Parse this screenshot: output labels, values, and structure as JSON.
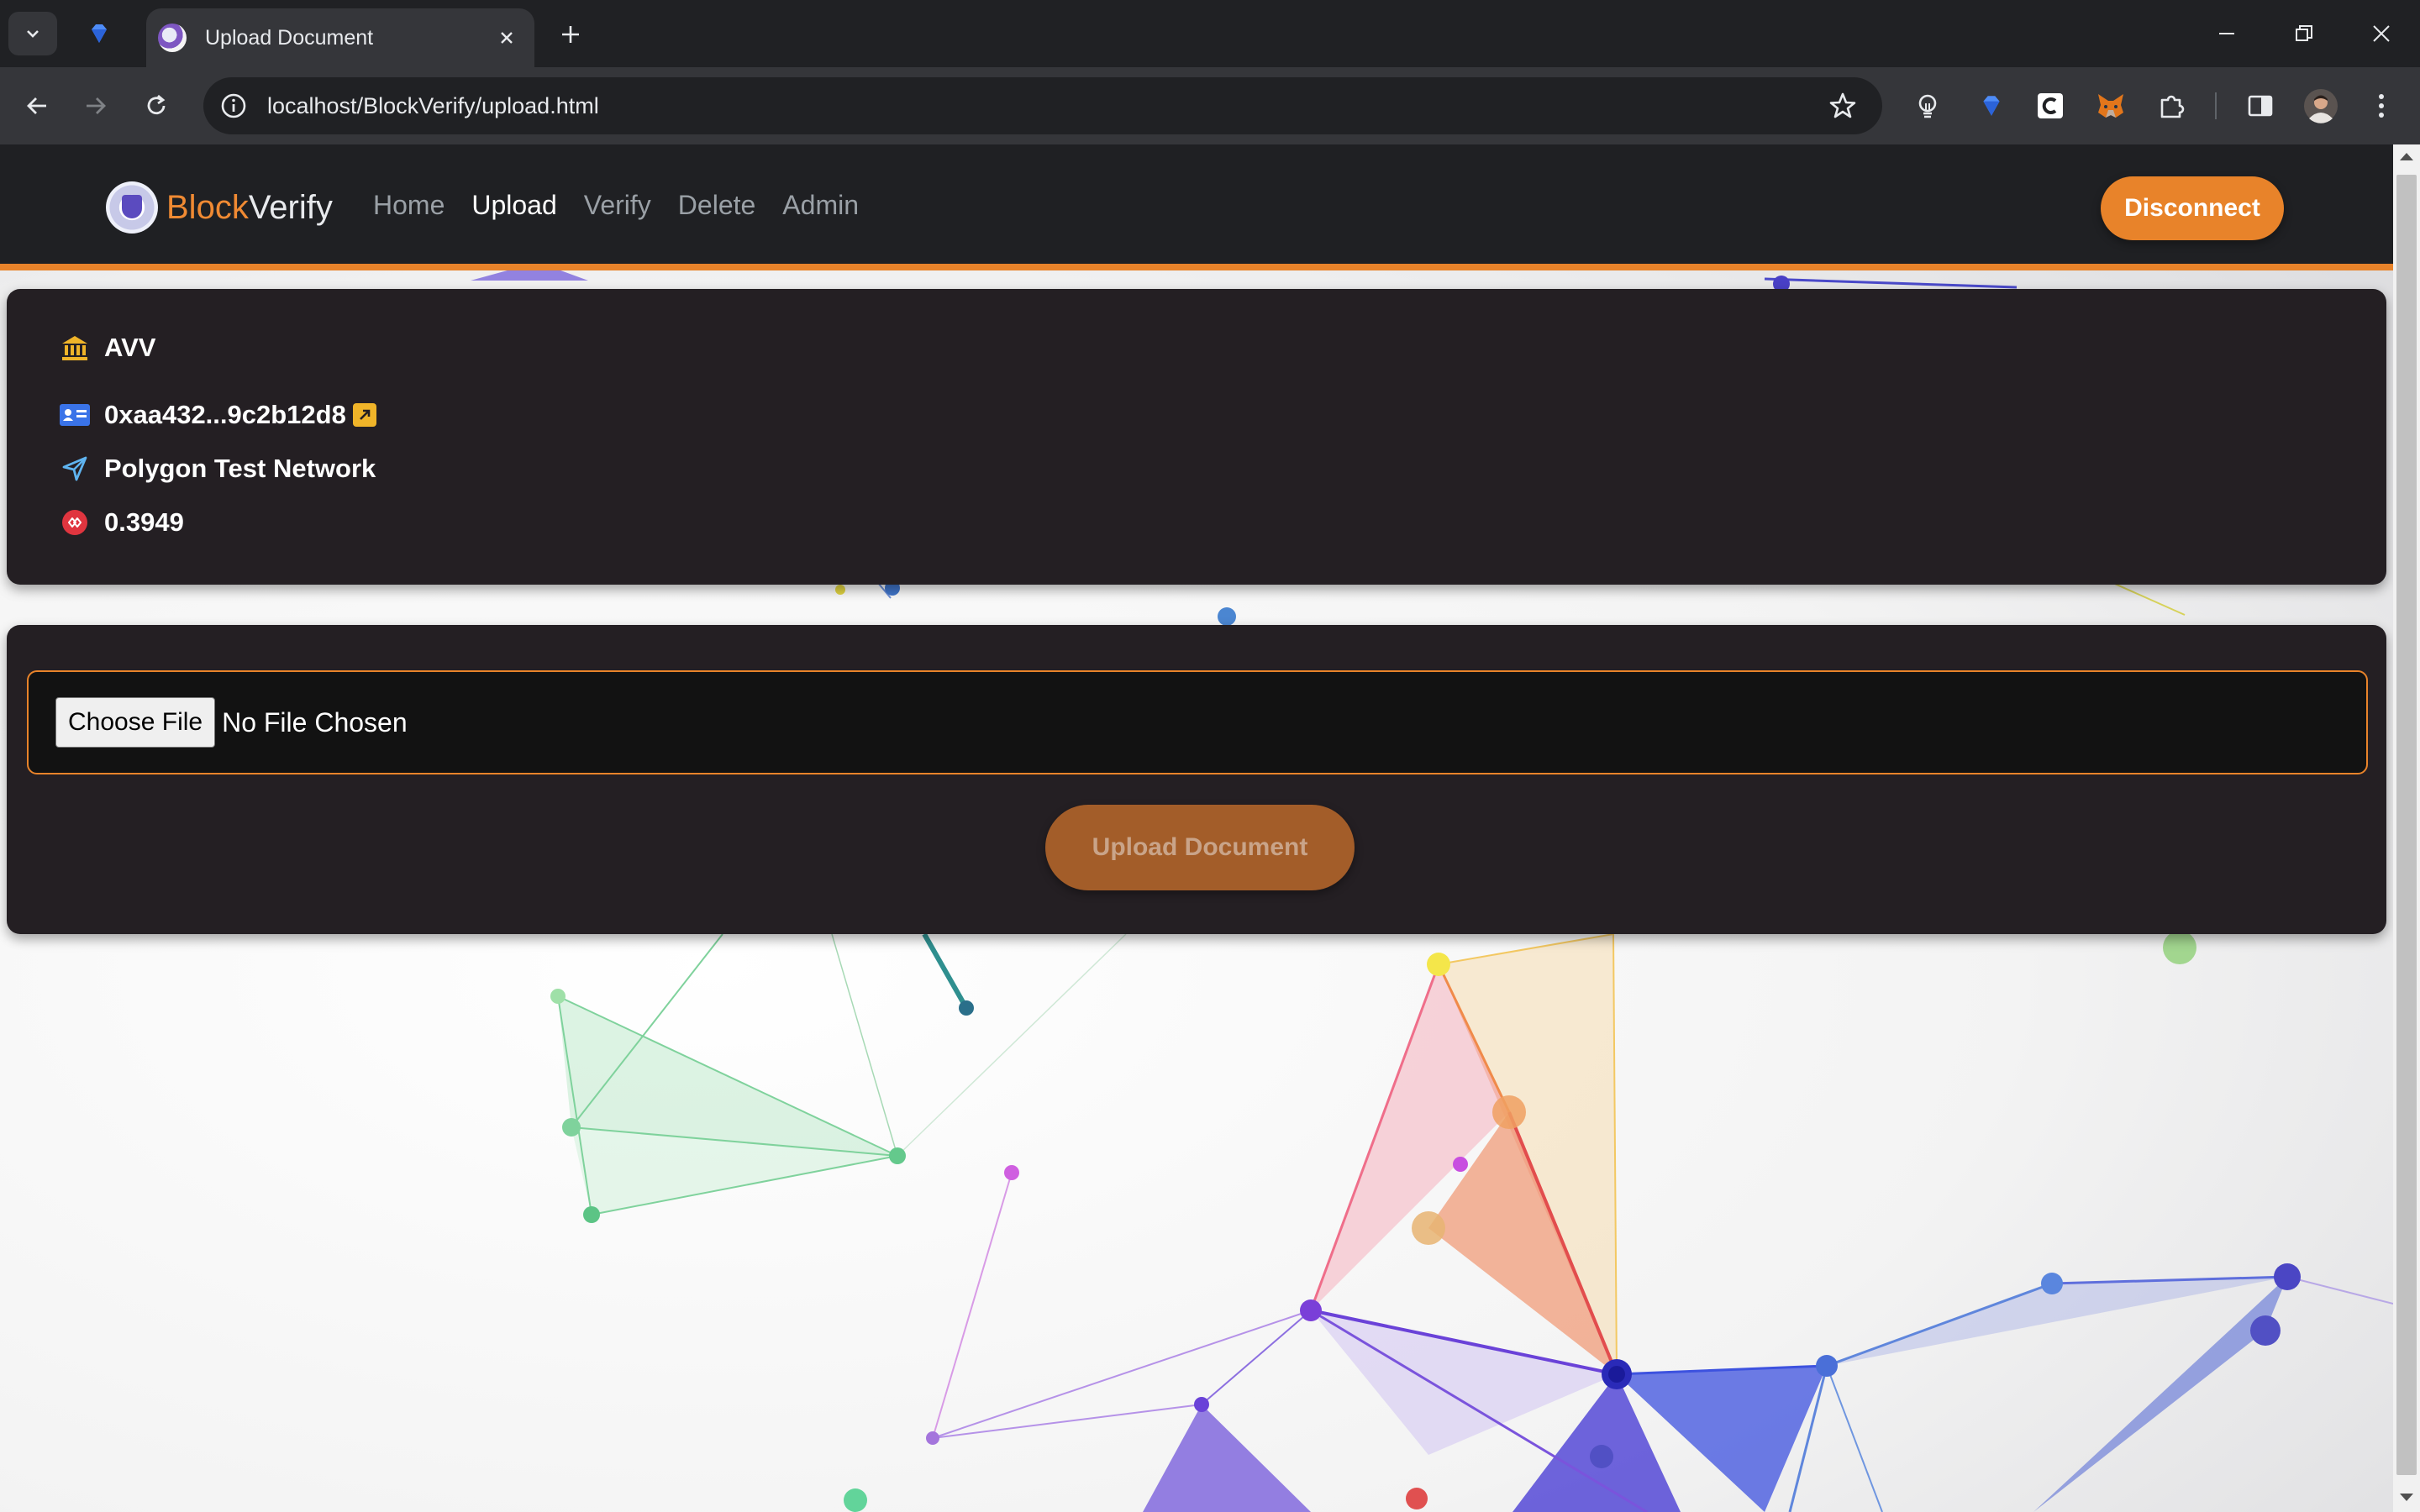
{
  "browser": {
    "tab_title": "Upload Document",
    "url": "localhost/BlockVerify/upload.html"
  },
  "site": {
    "brand_part1": "Block",
    "brand_part2": "Verify",
    "nav": [
      {
        "label": "Home",
        "active": false
      },
      {
        "label": "Upload",
        "active": true
      },
      {
        "label": "Verify",
        "active": false
      },
      {
        "label": "Delete",
        "active": false
      },
      {
        "label": "Admin",
        "active": false
      }
    ],
    "disconnect_label": "Disconnect",
    "accent_color": "#e8832a"
  },
  "account": {
    "institution": "AVV",
    "address": "0xaa432...9c2b12d8",
    "network": "Polygon Test Network",
    "balance": "0.3949"
  },
  "upload": {
    "choose_label": "Choose File",
    "file_status": "No File Chosen",
    "button_label": "Upload Document"
  },
  "icons": {
    "institution": "bank-icon",
    "address": "id-card-icon",
    "network": "send-icon",
    "balance": "polygon-token-icon"
  }
}
